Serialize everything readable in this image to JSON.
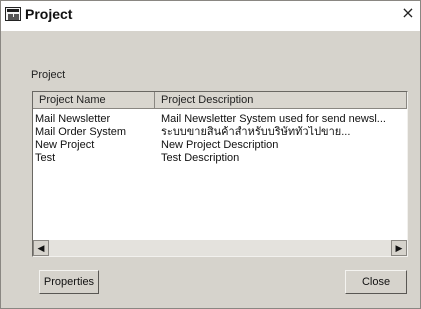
{
  "window": {
    "title": "Project",
    "close_glyph": "×"
  },
  "group": {
    "label": "Project"
  },
  "list": {
    "columns": [
      "Project Name",
      "Project Description"
    ],
    "rows": [
      {
        "name": "Mail Newsletter",
        "description": "Mail Newsletter System used for send newsl..."
      },
      {
        "name": "Mail Order System",
        "description": "ระบบขายสินค้าสำหรับบริษัททั่วไปขาย..."
      },
      {
        "name": "New Project",
        "description": "New Project Description"
      },
      {
        "name": "Test",
        "description": "Test Description"
      }
    ],
    "scroll_left_glyph": "◀",
    "scroll_right_glyph": "▶"
  },
  "buttons": {
    "properties": "Properties",
    "close": "Close"
  },
  "icons": {
    "window_icon": "project-window-icon"
  }
}
